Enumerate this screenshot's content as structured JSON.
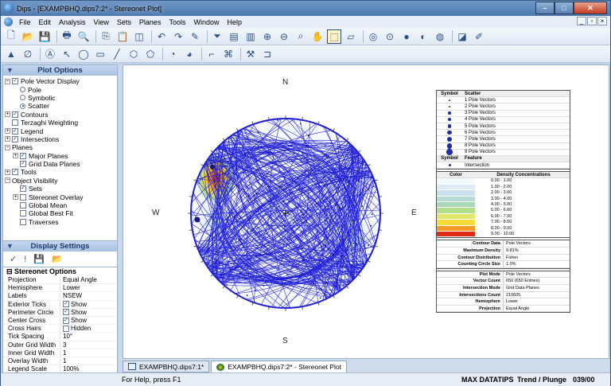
{
  "window": {
    "title": "Dips - [EXAMPBHQ.dips7:2* - Stereonet Plot]"
  },
  "menu": [
    "File",
    "Edit",
    "Analysis",
    "View",
    "Sets",
    "Planes",
    "Tools",
    "Window",
    "Help"
  ],
  "plot_options": {
    "title": "Plot Options",
    "tree": [
      {
        "label": "Pole Vector Display",
        "level": 0,
        "exp": "-",
        "kind": "cb",
        "checked": true
      },
      {
        "label": "Pole",
        "level": 1,
        "kind": "rb",
        "checked": false
      },
      {
        "label": "Symbolic",
        "level": 1,
        "kind": "rb",
        "checked": false
      },
      {
        "label": "Scatter",
        "level": 1,
        "kind": "rb",
        "checked": true
      },
      {
        "label": "Contours",
        "level": 0,
        "exp": "+",
        "kind": "cb",
        "checked": true
      },
      {
        "label": "Terzaghi Weighting",
        "level": 0,
        "exp": "",
        "kind": "cb",
        "checked": false
      },
      {
        "label": "Legend",
        "level": 0,
        "exp": "+",
        "kind": "cb",
        "checked": true
      },
      {
        "label": "Intersections",
        "level": 0,
        "exp": "+",
        "kind": "cb",
        "checked": true
      },
      {
        "label": "Planes",
        "level": 0,
        "exp": "-",
        "kind": "none"
      },
      {
        "label": "Major Planes",
        "level": 1,
        "exp": "+",
        "kind": "cb",
        "checked": true
      },
      {
        "label": "Grid Data Planes",
        "level": 1,
        "exp": "",
        "kind": "cb",
        "checked": true
      },
      {
        "label": "Tools",
        "level": 0,
        "exp": "+",
        "kind": "cb",
        "checked": true
      },
      {
        "label": "Object Visibility",
        "level": 0,
        "exp": "-",
        "kind": "none"
      },
      {
        "label": "Sets",
        "level": 1,
        "exp": "",
        "kind": "cb",
        "checked": true
      },
      {
        "label": "Stereonet Overlay",
        "level": 1,
        "exp": "+",
        "kind": "cb",
        "checked": false
      },
      {
        "label": "Global Mean",
        "level": 1,
        "exp": "",
        "kind": "cb",
        "checked": false
      },
      {
        "label": "Global Best Fit",
        "level": 1,
        "exp": "",
        "kind": "cb",
        "checked": false
      },
      {
        "label": "Traverses",
        "level": 1,
        "exp": "",
        "kind": "cb",
        "checked": false
      }
    ]
  },
  "display_settings": {
    "title": "Display Settings",
    "section": "Stereonet Options",
    "rows": [
      {
        "k": "Projection",
        "v": "Equal Angle",
        "cb": null
      },
      {
        "k": "Hemisphere",
        "v": "Lower",
        "cb": null
      },
      {
        "k": "Labels",
        "v": "NSEW",
        "cb": null
      },
      {
        "k": "Exterior Ticks",
        "v": "Show",
        "cb": true
      },
      {
        "k": "Perimeter Circle",
        "v": "Show",
        "cb": true
      },
      {
        "k": "Center Cross",
        "v": "Show",
        "cb": true
      },
      {
        "k": "Cross Hairs",
        "v": "Hidden",
        "cb": false
      },
      {
        "k": "Tick Spacing",
        "v": "10°",
        "cb": null
      },
      {
        "k": "Outer Grid Width",
        "v": "3",
        "cb": null
      },
      {
        "k": "Inner Grid Width",
        "v": "1",
        "cb": null
      },
      {
        "k": "Overlay Width",
        "v": "1",
        "cb": null
      },
      {
        "k": "Legend Scale",
        "v": "100%",
        "cb": null
      }
    ]
  },
  "stereonet": {
    "n": "N",
    "s": "S",
    "e": "E",
    "w": "W"
  },
  "legend": {
    "scatter_head": [
      "Symbol",
      "Scatter"
    ],
    "scatter": [
      "1 Pole Vectors",
      "2 Pole Vectors",
      "3 Pole Vectors",
      "4 Pole Vectors",
      "5 Pole Vectors",
      "6 Pole Vectors",
      "7 Pole Vectors",
      "8 Pole Vectors",
      "9 Pole Vectors"
    ],
    "feature_head": [
      "Symbol",
      "Feature"
    ],
    "feature": "Intersection",
    "density_head": [
      "Color",
      "Density Concentrations"
    ],
    "density": [
      {
        "c": "#f4f9fd",
        "r": "0.00    -    1.00"
      },
      {
        "c": "#dde9f4",
        "r": "1.00    -    2.00"
      },
      {
        "c": "#c9e0ee",
        "r": "2.00    -    3.00"
      },
      {
        "c": "#b6dcd5",
        "r": "3.00    -    4.00"
      },
      {
        "c": "#a8d8b8",
        "r": "4.00    -    5.00"
      },
      {
        "c": "#b3de8a",
        "r": "5.00    -    6.00"
      },
      {
        "c": "#dfe86a",
        "r": "6.00    -    7.00"
      },
      {
        "c": "#f7dd3a",
        "r": "7.00    -    8.00"
      },
      {
        "c": "#f59b25",
        "r": "8.00    -    9.00"
      },
      {
        "c": "#e12a16",
        "r": "9.00    -    10.00"
      }
    ],
    "info1": [
      [
        "Contour Data",
        "Pole Vectors"
      ],
      [
        "Maximum Density",
        "9.81%"
      ],
      [
        "Contour Distribution",
        "Fisher"
      ],
      [
        "Counting Circle Size",
        "1.0%"
      ]
    ],
    "info2": [
      [
        "Plot Mode",
        "Pole Vectors"
      ],
      [
        "Vector Count",
        "650 (650 Entries)"
      ],
      [
        "Intersection Mode",
        "Grid Data Planes"
      ],
      [
        "Intersections Count",
        "210605"
      ],
      [
        "Hemisphere",
        "Lower"
      ],
      [
        "Projection",
        "Equal Angle"
      ]
    ]
  },
  "tabs": [
    {
      "label": "EXAMPBHQ.dips7:1*",
      "selected": false
    },
    {
      "label": "EXAMPBHQ.dips7:2* - Stereonet Plot",
      "selected": true
    }
  ],
  "status": {
    "help": "For Help, press F1",
    "mode": "MAX DATATIPS",
    "trend_label": "Trend / Plunge",
    "trend_value": "039/00"
  },
  "colors": {
    "net": "#1f1fd6",
    "accent": "#4c77ad"
  }
}
